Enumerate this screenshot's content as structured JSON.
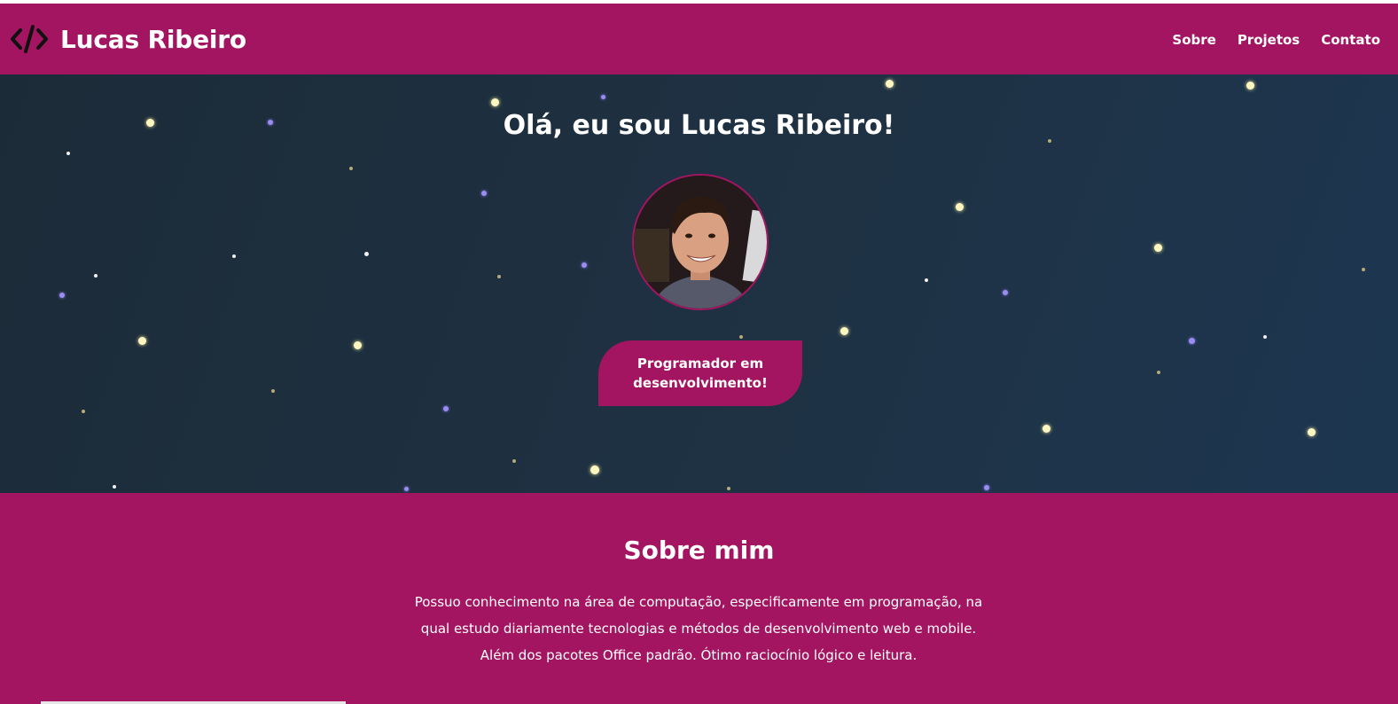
{
  "navbar": {
    "icon": "code-brackets-icon",
    "brand_name": "Lucas Ribeiro",
    "links": [
      {
        "label": "Sobre"
      },
      {
        "label": "Projetos"
      },
      {
        "label": "Contato"
      }
    ]
  },
  "hero": {
    "title": "Olá, eu sou Lucas Ribeiro!",
    "avatar": "profile-photo",
    "role": "Programador em desenvolvimento!"
  },
  "about": {
    "title": "Sobre mim",
    "text": "Possuo conhecimento na área de computação, especificamente em programação, na qual estudo diariamente tecnologias e métodos de desenvolvimento web e mobile. Além dos pacotes Office padrão. Ótimo raciocínio lógico e leitura."
  },
  "colors": {
    "primary": "#a31561",
    "hero_bg": "#1e3142",
    "text": "#ffffff",
    "star_yellow": "#fff7c2",
    "star_purple": "#9a8cf0"
  }
}
